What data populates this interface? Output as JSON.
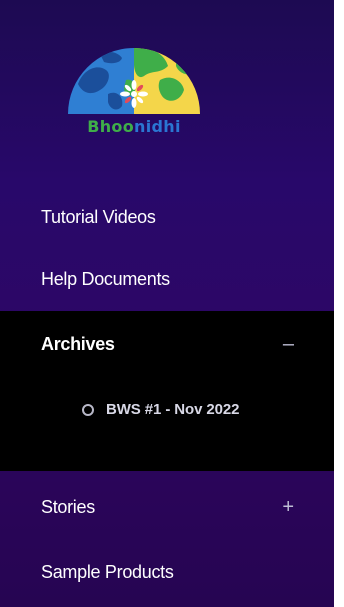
{
  "logo": {
    "text_part1": "Bhoo",
    "text_part2": "nidhi"
  },
  "menu": {
    "tutorial_videos": "Tutorial Videos",
    "help_documents": "Help Documents",
    "archives": {
      "label": "Archives",
      "toggle": "–",
      "expanded": true,
      "children": [
        {
          "label": "BWS #1 - Nov 2022"
        }
      ]
    },
    "stories": {
      "label": "Stories",
      "toggle": "+",
      "expanded": false
    },
    "sample_products": "Sample Products"
  },
  "colors": {
    "sidebar_top": "#1d0a52",
    "sidebar_bottom": "#260552",
    "active_section_bg": "#000000",
    "logo_green": "#3fae49",
    "logo_blue": "#2a76d2"
  }
}
